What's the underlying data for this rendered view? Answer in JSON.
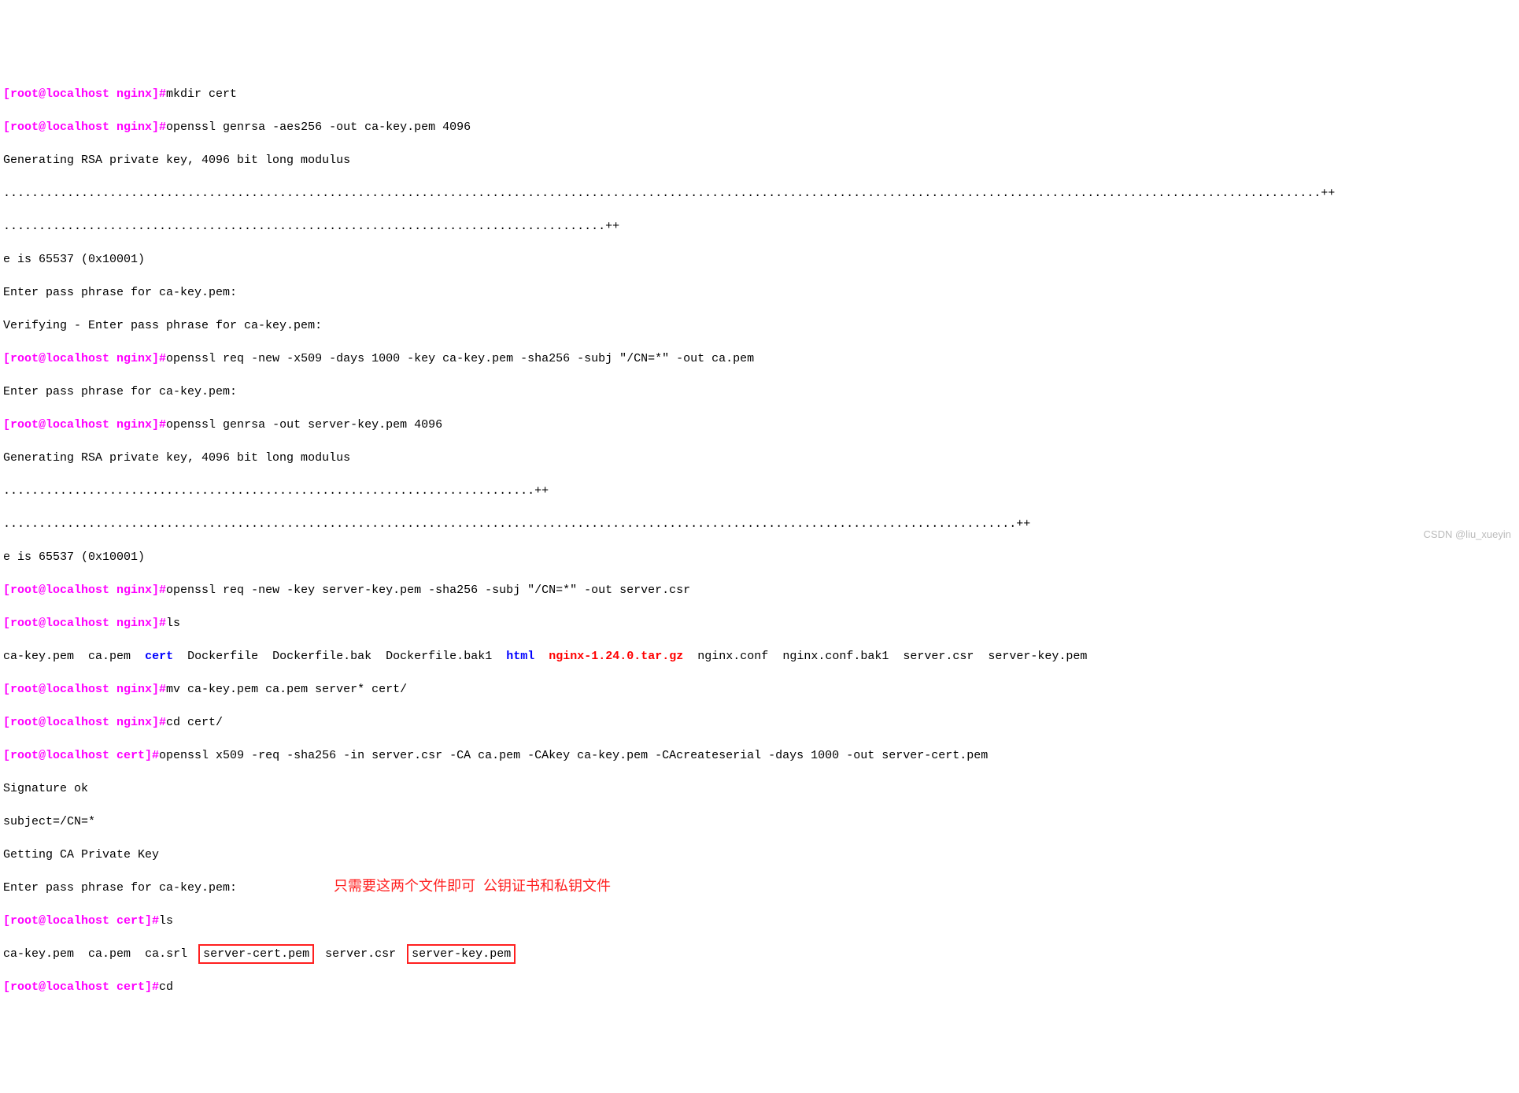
{
  "prompt_nginx": "[root@localhost nginx]#",
  "prompt_cert": "[root@localhost cert]#",
  "cmd": {
    "mkdir": "mkdir cert",
    "genrsa1": "openssl genrsa -aes256 -out ca-key.pem 4096",
    "req1": "openssl req -new -x509 -days 1000 -key ca-key.pem -sha256 -subj \"/CN=*\" -out ca.pem",
    "genrsa2": "openssl genrsa -out server-key.pem 4096",
    "req2": "openssl req -new -key server-key.pem -sha256 -subj \"/CN=*\" -out server.csr",
    "ls": "ls",
    "mv": "mv ca-key.pem ca.pem server* cert/",
    "cd": "cd cert/",
    "x509": "openssl x509 -req -sha256 -in server.csr -CA ca.pem -CAkey ca-key.pem -CAcreateserial -days 1000 -out server-cert.pem",
    "ls2": "ls",
    "cdlast": "cd"
  },
  "out": {
    "gen4096": "Generating RSA private key, 4096 bit long modulus",
    "dots1": "..........................................................................................................................................................................................++",
    "dots2": ".....................................................................................++",
    "e65537": "e is 65537 (0x10001)",
    "enterpp": "Enter pass phrase for ca-key.pem:",
    "verifypp": "Verifying - Enter pass phrase for ca-key.pem:",
    "dots3": "...........................................................................++",
    "dots4": "...............................................................................................................................................++",
    "sigok": "Signature ok",
    "subj": "subject=/CN=*",
    "getcakey": "Getting CA Private Key"
  },
  "ls1": {
    "f1": "ca-key.pem",
    "f2": "ca.pem",
    "d1": "cert",
    "f3": "Dockerfile",
    "f4": "Dockerfile.bak",
    "f5": "Dockerfile.bak1",
    "d2": "html",
    "r1": "nginx-1.24.0.tar.gz",
    "f6": "nginx.conf",
    "f7": "nginx.conf.bak1",
    "f8": "server.csr",
    "f9": "server-key.pem"
  },
  "ls2": {
    "f1": "ca-key.pem",
    "f2": "ca.pem",
    "f3": "ca.srl",
    "box1": "server-cert.pem",
    "f4": "server.csr",
    "box2": "server-key.pem"
  },
  "annotation": "只需要这两个文件即可  公钥证书和私钥文件",
  "watermark": "CSDN @liu_xueyin"
}
